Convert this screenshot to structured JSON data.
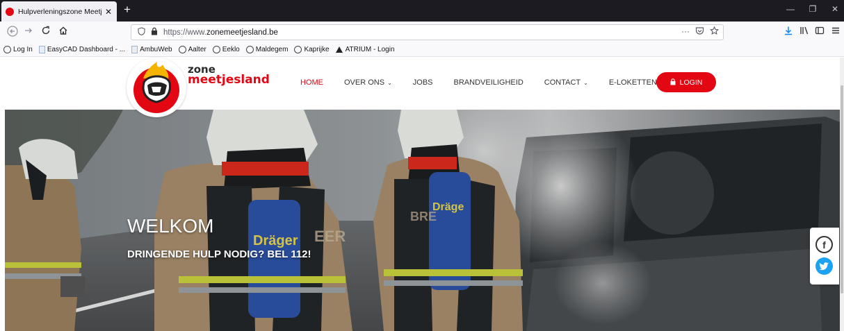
{
  "browser": {
    "tab_title": "Hulpverleningszone Meetjeslan",
    "tab_close": "✕",
    "new_tab": "+",
    "url_prefix": "https://www.",
    "url_host": "zonemeetjesland.be",
    "url_more": "···",
    "controls": {
      "minimize": "—",
      "maximize": "❐",
      "close": "✕"
    }
  },
  "bookmarks": [
    {
      "label": "Log In",
      "icon": "globe"
    },
    {
      "label": "EasyCAD Dashboard - ...",
      "icon": "doc"
    },
    {
      "label": "AmbuWeb",
      "icon": "doc"
    },
    {
      "label": "Aalter",
      "icon": "globe"
    },
    {
      "label": "Eeklo",
      "icon": "globe"
    },
    {
      "label": "Maldegem",
      "icon": "globe"
    },
    {
      "label": "Kaprijke",
      "icon": "globe"
    },
    {
      "label": "ATRIUM - Login",
      "icon": "triangle"
    }
  ],
  "site": {
    "logo_line1": "zone",
    "logo_line2": "meetjesland",
    "menu": [
      {
        "label": "HOME",
        "active": true,
        "dropdown": false
      },
      {
        "label": "OVER ONS",
        "active": false,
        "dropdown": true
      },
      {
        "label": "JOBS",
        "active": false,
        "dropdown": false
      },
      {
        "label": "BRANDVEILIGHEID",
        "active": false,
        "dropdown": false
      },
      {
        "label": "CONTACT",
        "active": false,
        "dropdown": true
      },
      {
        "label": "E-LOKETTEN",
        "active": false,
        "dropdown": true
      }
    ],
    "login_label": "LOGIN",
    "accent_color": "#e30613"
  },
  "hero": {
    "title": "WELKOM",
    "subtitle": "DRINGENDE HULP NODIG? BEL 112!",
    "helmet_brand": "Dräger"
  },
  "social": {
    "facebook": "f",
    "twitter": "t"
  }
}
